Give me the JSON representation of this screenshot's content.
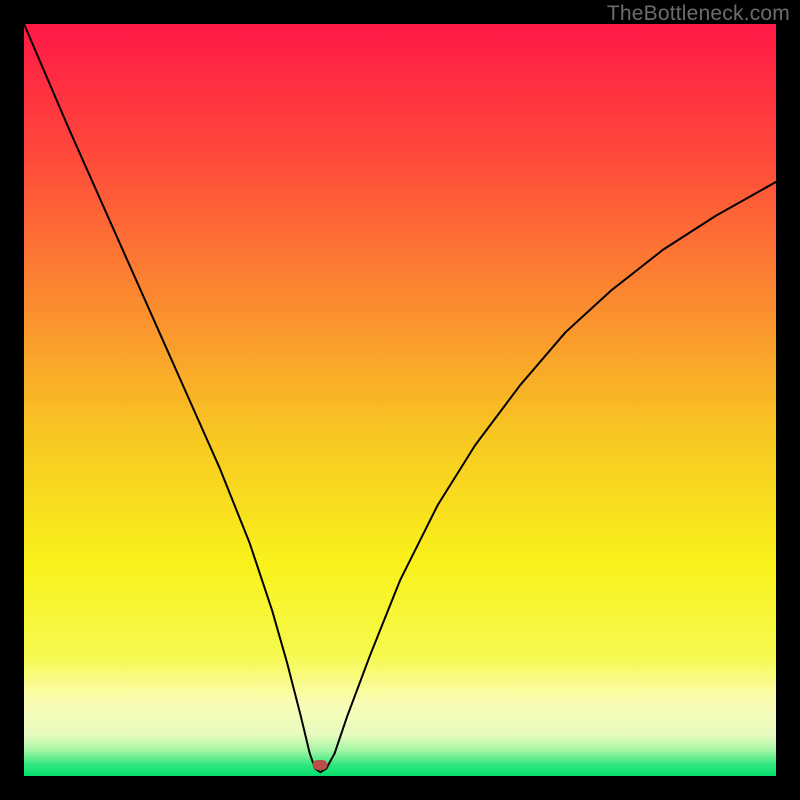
{
  "watermark": {
    "text": "TheBottleneck.com"
  },
  "colors": {
    "black": "#000000",
    "marker": "#B94F48",
    "curve": "#000000"
  },
  "chart_data": {
    "type": "line",
    "title": "",
    "xlabel": "",
    "ylabel": "",
    "xlim": [
      0,
      100
    ],
    "ylim": [
      0,
      100
    ],
    "grid": false,
    "legend": false,
    "background_gradient": [
      {
        "pos": 0.0,
        "color": "#FF1846"
      },
      {
        "pos": 0.18,
        "color": "#FF4B3A"
      },
      {
        "pos": 0.38,
        "color": "#FA8E2F"
      },
      {
        "pos": 0.55,
        "color": "#F8C822"
      },
      {
        "pos": 0.72,
        "color": "#F9F21B"
      },
      {
        "pos": 0.84,
        "color": "#F6FA4F"
      },
      {
        "pos": 0.9,
        "color": "#FBFCB4"
      },
      {
        "pos": 0.945,
        "color": "#E7FBBF"
      },
      {
        "pos": 0.965,
        "color": "#A8F6A5"
      },
      {
        "pos": 0.985,
        "color": "#30E77F"
      },
      {
        "pos": 1.0,
        "color": "#06DE6D"
      }
    ],
    "series": [
      {
        "name": "bottleneck-curve",
        "x": [
          0,
          3,
          6,
          10,
          14,
          18,
          22,
          26,
          30,
          33,
          35,
          36.8,
          38,
          38.7,
          39.4,
          40.2,
          41.3,
          43,
          46,
          50,
          55,
          60,
          66,
          72,
          78,
          85,
          92,
          100
        ],
        "y": [
          100,
          93,
          86,
          77,
          68,
          59,
          50,
          41,
          31,
          22,
          15,
          8,
          3,
          1,
          0.5,
          1,
          3,
          8,
          16,
          26,
          36,
          44,
          52,
          59,
          64.5,
          70,
          74.5,
          79
        ]
      }
    ],
    "marker": {
      "x": 39.4,
      "y": 1.4,
      "color": "#B94F48"
    }
  }
}
